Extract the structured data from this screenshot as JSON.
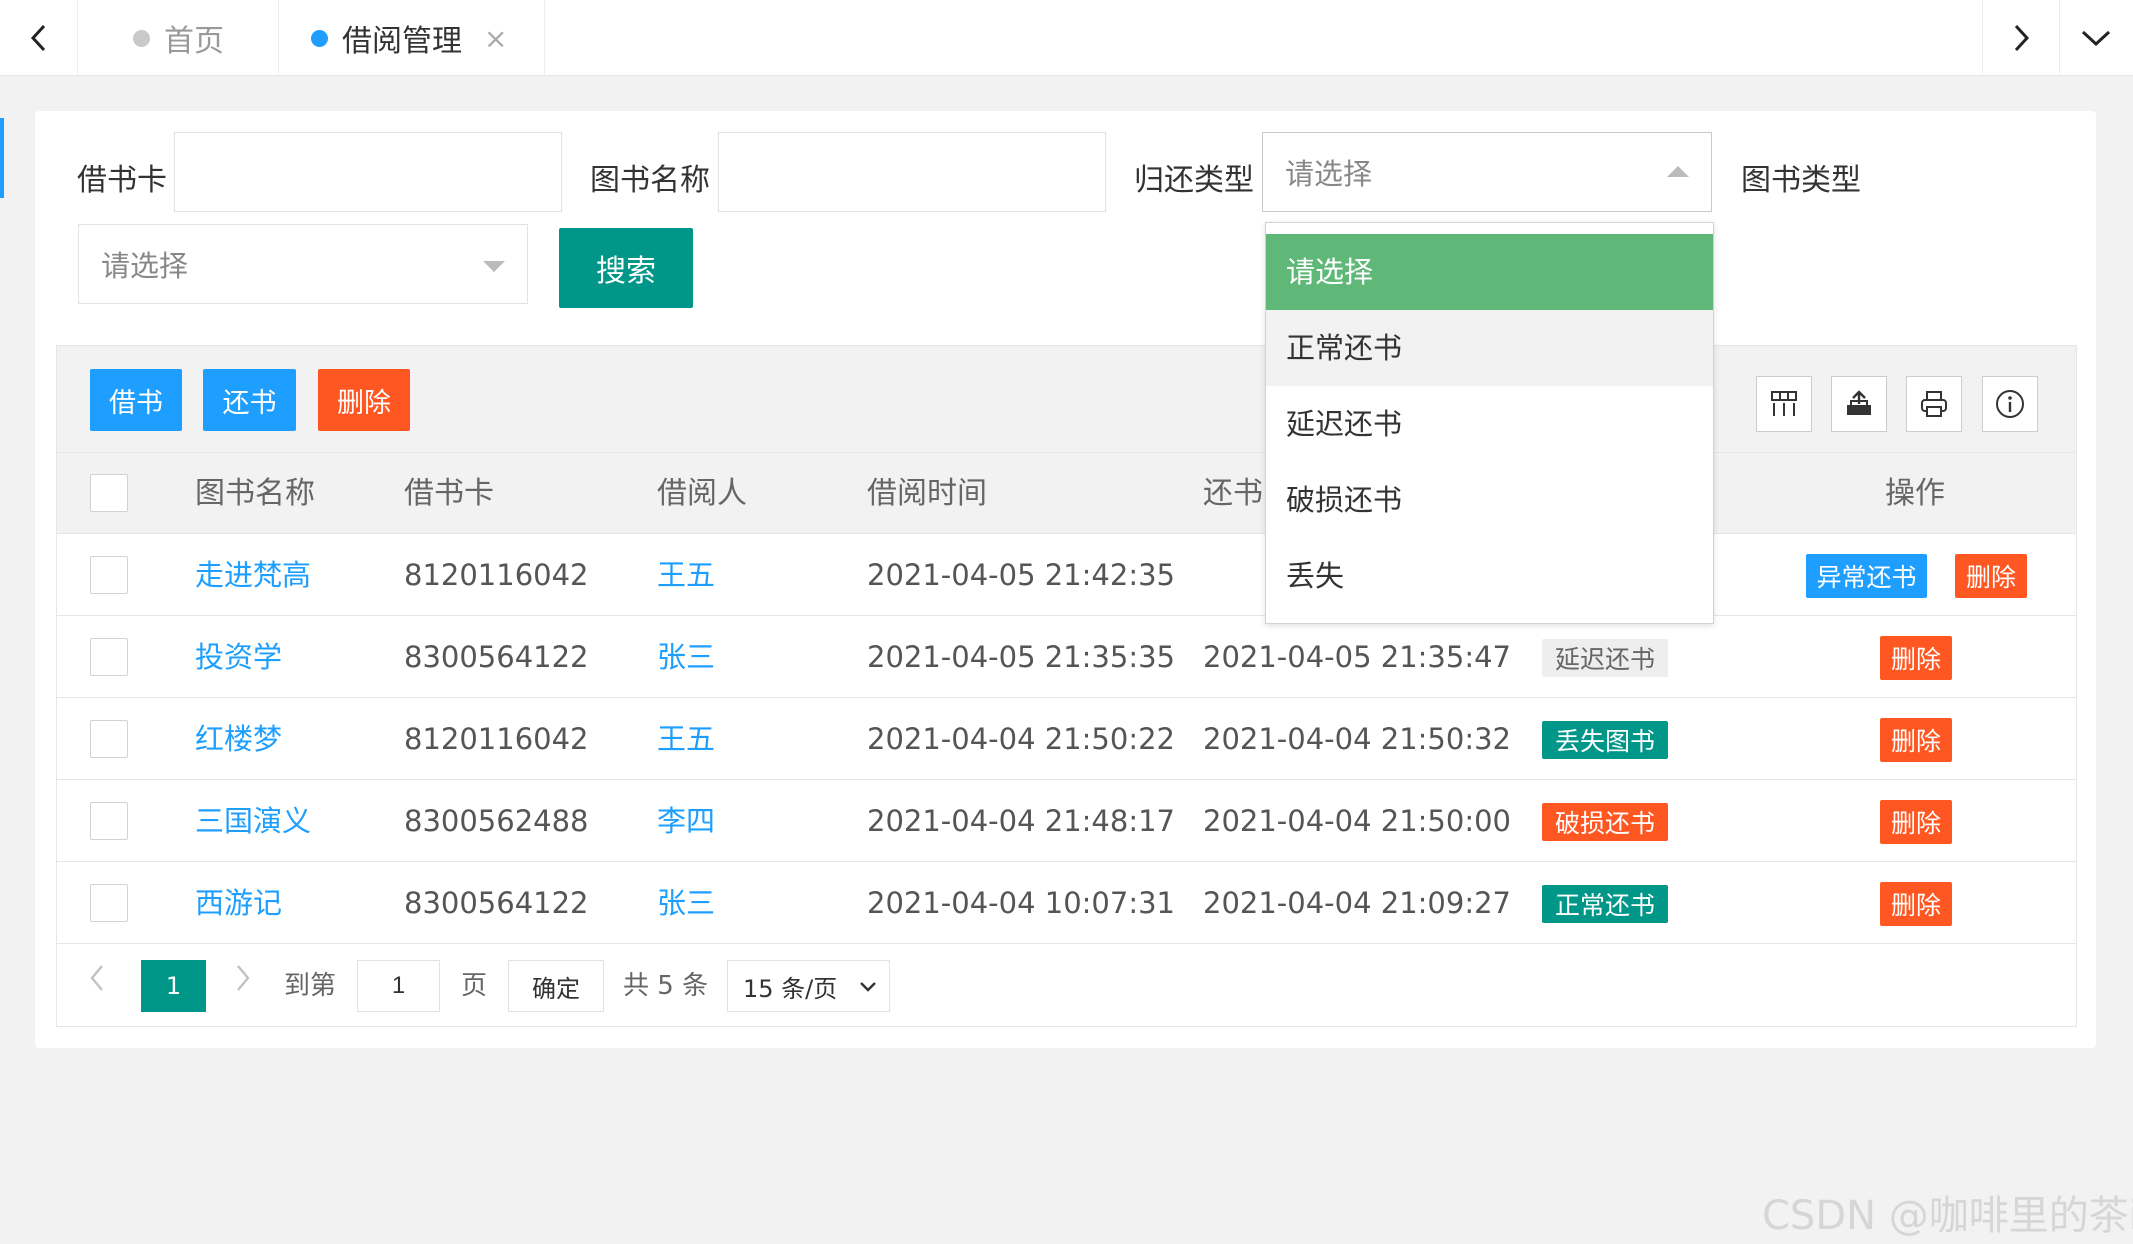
{
  "tabs": [
    {
      "label": "首页",
      "active": false
    },
    {
      "label": "借阅管理",
      "active": true
    }
  ],
  "tab_close_glyph": "×",
  "filters": {
    "card_label": "借书卡",
    "card_value": "",
    "book_name_label": "图书名称",
    "book_name_value": "",
    "return_type_label": "归还类型",
    "return_type_value": "请选择",
    "book_type_label": "图书类型",
    "book_type_value": "请选择",
    "search_label": "搜索"
  },
  "dropdown": {
    "options": [
      "请选择",
      "正常还书",
      "延迟还书",
      "破损还书",
      "丢失"
    ],
    "selected_index": 0,
    "hover_index": 1,
    "selected_color": "#5fb878"
  },
  "toolbar": {
    "borrow_label": "借书",
    "return_label": "还书",
    "delete_label": "删除",
    "icons": [
      "columns-icon",
      "export-icon",
      "print-icon",
      "info-icon"
    ]
  },
  "table": {
    "headers": [
      "图书名称",
      "借书卡",
      "借阅人",
      "借阅时间",
      "还书",
      "操作"
    ],
    "rows": [
      {
        "book": "走进梵高",
        "card": "8120116042",
        "borrower": "王五",
        "borrow_time": "2021-04-05 21:42:35",
        "return_time": "",
        "status": "",
        "status_type": "",
        "actions": [
          "异常还书",
          "删除"
        ]
      },
      {
        "book": "投资学",
        "card": "8300564122",
        "borrower": "张三",
        "borrow_time": "2021-04-05 21:35:35",
        "return_time": "2021-04-05 21:35:47",
        "status": "延迟还书",
        "status_type": "gray",
        "actions": [
          "删除"
        ]
      },
      {
        "book": "红楼梦",
        "card": "8120116042",
        "borrower": "王五",
        "borrow_time": "2021-04-04 21:50:22",
        "return_time": "2021-04-04 21:50:32",
        "status": "丢失图书",
        "status_type": "green",
        "actions": [
          "删除"
        ]
      },
      {
        "book": "三国演义",
        "card": "8300562488",
        "borrower": "李四",
        "borrow_time": "2021-04-04 21:48:17",
        "return_time": "2021-04-04 21:50:00",
        "status": "破损还书",
        "status_type": "orange",
        "actions": [
          "删除"
        ]
      },
      {
        "book": "西游记",
        "card": "8300564122",
        "borrower": "张三",
        "borrow_time": "2021-04-04 10:07:31",
        "return_time": "2021-04-04 21:09:27",
        "status": "正常还书",
        "status_type": "green",
        "actions": [
          "删除"
        ]
      }
    ]
  },
  "pagination": {
    "current_page": "1",
    "goto_label": "到第",
    "goto_value": "1",
    "page_suffix": "页",
    "confirm_label": "确定",
    "total_label": "共 5 条",
    "per_page": "15 条/页"
  },
  "colors": {
    "primary_blue": "#1e9fff",
    "teal": "#009688",
    "orange": "#ff5722",
    "dropdown_green": "#5fb878"
  },
  "watermark": "CSDN @咖啡里的茶i"
}
